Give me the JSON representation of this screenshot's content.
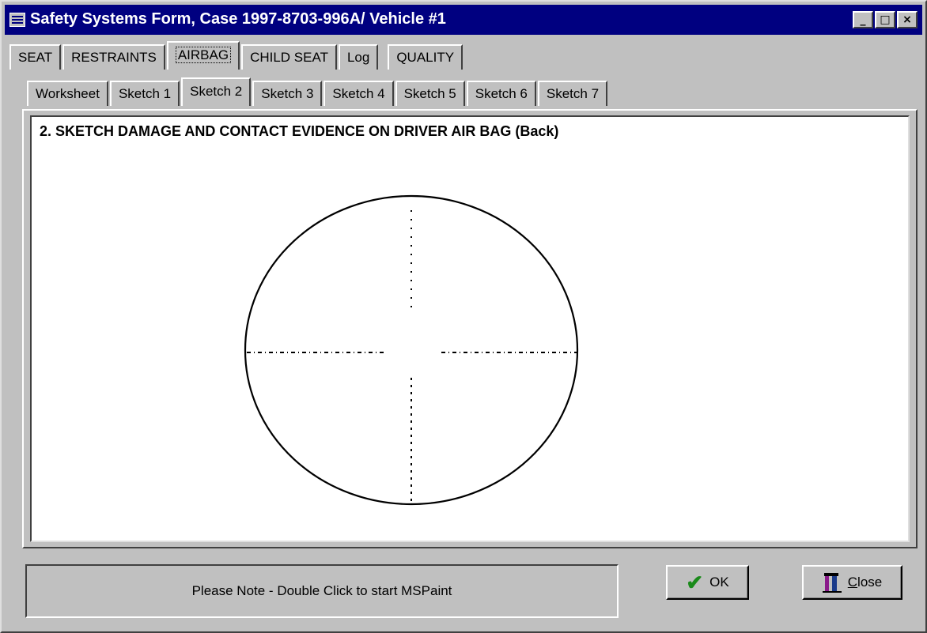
{
  "window": {
    "title": "Safety Systems Form, Case 1997-8703-996A/ Vehicle #1",
    "controls": [
      "minimize",
      "maximize",
      "close"
    ]
  },
  "top_tabs": [
    "SEAT",
    "RESTRAINTS",
    "AIRBAG",
    "CHILD SEAT",
    "Log",
    "QUALITY"
  ],
  "top_tab_active": "AIRBAG",
  "sub_tabs": [
    "Worksheet",
    "Sketch 1",
    "Sketch 2",
    "Sketch 3",
    "Sketch 4",
    "Sketch 5",
    "Sketch 6",
    "Sketch 7"
  ],
  "sub_tab_active": "Sketch 2",
  "sketch": {
    "heading": "2. SKETCH DAMAGE AND CONTACT EVIDENCE ON DRIVER AIR BAG (Back)"
  },
  "status": {
    "note": "Please Note  - Double Click to start MSPaint"
  },
  "buttons": {
    "ok": "OK",
    "close_prefix": "",
    "close_underlined": "C",
    "close_rest": "lose"
  },
  "icons": {
    "ok": "checkmark-icon",
    "close": "door-exit-icon"
  },
  "colors": {
    "titlebar": "#000080",
    "face": "#c0c0c0",
    "check": "#1a8a1a"
  }
}
